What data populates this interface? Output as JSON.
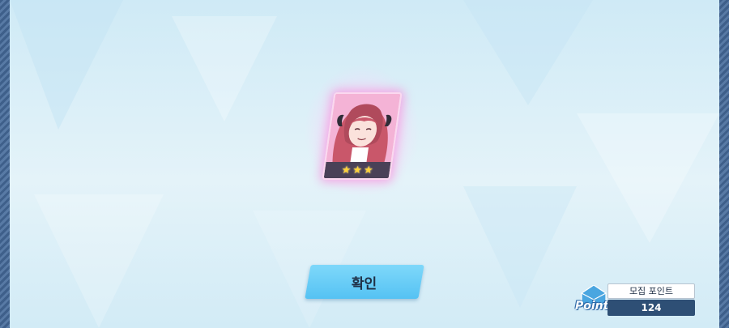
{
  "result": {
    "star_count": 3,
    "star_glyph": "★",
    "card_colors": {
      "frame": "#f3a5cf",
      "glow": "#f68cdc",
      "star_bar": "#4a4157",
      "star": "#ffd33a"
    }
  },
  "confirm_button": {
    "label": "확인"
  },
  "recruit_points": {
    "logo_text": "Point",
    "label": "모집 포인트",
    "value": "124"
  },
  "colors": {
    "button": "#55c2f3",
    "border": "#3e5f8a",
    "points_panel": "#2e4f75"
  }
}
